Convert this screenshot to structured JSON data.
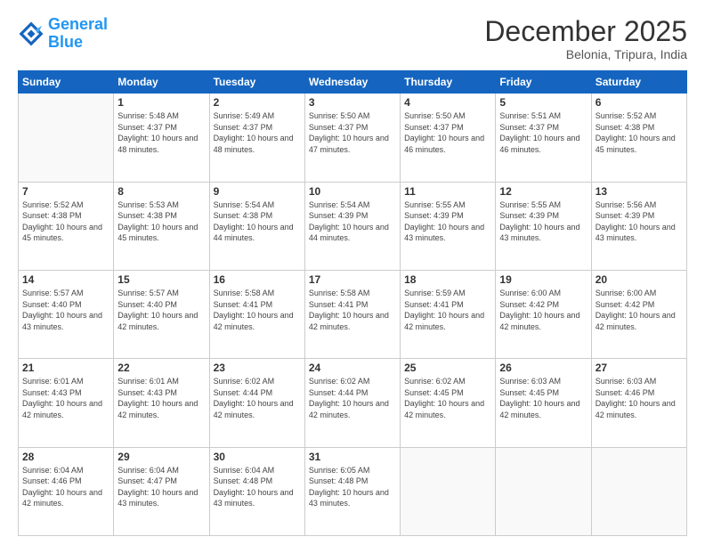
{
  "logo": {
    "line1": "General",
    "line2": "Blue"
  },
  "header": {
    "title": "December 2025",
    "location": "Belonia, Tripura, India"
  },
  "weekdays": [
    "Sunday",
    "Monday",
    "Tuesday",
    "Wednesday",
    "Thursday",
    "Friday",
    "Saturday"
  ],
  "weeks": [
    [
      {
        "day": "",
        "sunrise": "",
        "sunset": "",
        "daylight": ""
      },
      {
        "day": "1",
        "sunrise": "Sunrise: 5:48 AM",
        "sunset": "Sunset: 4:37 PM",
        "daylight": "Daylight: 10 hours and 48 minutes."
      },
      {
        "day": "2",
        "sunrise": "Sunrise: 5:49 AM",
        "sunset": "Sunset: 4:37 PM",
        "daylight": "Daylight: 10 hours and 48 minutes."
      },
      {
        "day": "3",
        "sunrise": "Sunrise: 5:50 AM",
        "sunset": "Sunset: 4:37 PM",
        "daylight": "Daylight: 10 hours and 47 minutes."
      },
      {
        "day": "4",
        "sunrise": "Sunrise: 5:50 AM",
        "sunset": "Sunset: 4:37 PM",
        "daylight": "Daylight: 10 hours and 46 minutes."
      },
      {
        "day": "5",
        "sunrise": "Sunrise: 5:51 AM",
        "sunset": "Sunset: 4:37 PM",
        "daylight": "Daylight: 10 hours and 46 minutes."
      },
      {
        "day": "6",
        "sunrise": "Sunrise: 5:52 AM",
        "sunset": "Sunset: 4:38 PM",
        "daylight": "Daylight: 10 hours and 45 minutes."
      }
    ],
    [
      {
        "day": "7",
        "sunrise": "Sunrise: 5:52 AM",
        "sunset": "Sunset: 4:38 PM",
        "daylight": "Daylight: 10 hours and 45 minutes."
      },
      {
        "day": "8",
        "sunrise": "Sunrise: 5:53 AM",
        "sunset": "Sunset: 4:38 PM",
        "daylight": "Daylight: 10 hours and 45 minutes."
      },
      {
        "day": "9",
        "sunrise": "Sunrise: 5:54 AM",
        "sunset": "Sunset: 4:38 PM",
        "daylight": "Daylight: 10 hours and 44 minutes."
      },
      {
        "day": "10",
        "sunrise": "Sunrise: 5:54 AM",
        "sunset": "Sunset: 4:39 PM",
        "daylight": "Daylight: 10 hours and 44 minutes."
      },
      {
        "day": "11",
        "sunrise": "Sunrise: 5:55 AM",
        "sunset": "Sunset: 4:39 PM",
        "daylight": "Daylight: 10 hours and 43 minutes."
      },
      {
        "day": "12",
        "sunrise": "Sunrise: 5:55 AM",
        "sunset": "Sunset: 4:39 PM",
        "daylight": "Daylight: 10 hours and 43 minutes."
      },
      {
        "day": "13",
        "sunrise": "Sunrise: 5:56 AM",
        "sunset": "Sunset: 4:39 PM",
        "daylight": "Daylight: 10 hours and 43 minutes."
      }
    ],
    [
      {
        "day": "14",
        "sunrise": "Sunrise: 5:57 AM",
        "sunset": "Sunset: 4:40 PM",
        "daylight": "Daylight: 10 hours and 43 minutes."
      },
      {
        "day": "15",
        "sunrise": "Sunrise: 5:57 AM",
        "sunset": "Sunset: 4:40 PM",
        "daylight": "Daylight: 10 hours and 42 minutes."
      },
      {
        "day": "16",
        "sunrise": "Sunrise: 5:58 AM",
        "sunset": "Sunset: 4:41 PM",
        "daylight": "Daylight: 10 hours and 42 minutes."
      },
      {
        "day": "17",
        "sunrise": "Sunrise: 5:58 AM",
        "sunset": "Sunset: 4:41 PM",
        "daylight": "Daylight: 10 hours and 42 minutes."
      },
      {
        "day": "18",
        "sunrise": "Sunrise: 5:59 AM",
        "sunset": "Sunset: 4:41 PM",
        "daylight": "Daylight: 10 hours and 42 minutes."
      },
      {
        "day": "19",
        "sunrise": "Sunrise: 6:00 AM",
        "sunset": "Sunset: 4:42 PM",
        "daylight": "Daylight: 10 hours and 42 minutes."
      },
      {
        "day": "20",
        "sunrise": "Sunrise: 6:00 AM",
        "sunset": "Sunset: 4:42 PM",
        "daylight": "Daylight: 10 hours and 42 minutes."
      }
    ],
    [
      {
        "day": "21",
        "sunrise": "Sunrise: 6:01 AM",
        "sunset": "Sunset: 4:43 PM",
        "daylight": "Daylight: 10 hours and 42 minutes."
      },
      {
        "day": "22",
        "sunrise": "Sunrise: 6:01 AM",
        "sunset": "Sunset: 4:43 PM",
        "daylight": "Daylight: 10 hours and 42 minutes."
      },
      {
        "day": "23",
        "sunrise": "Sunrise: 6:02 AM",
        "sunset": "Sunset: 4:44 PM",
        "daylight": "Daylight: 10 hours and 42 minutes."
      },
      {
        "day": "24",
        "sunrise": "Sunrise: 6:02 AM",
        "sunset": "Sunset: 4:44 PM",
        "daylight": "Daylight: 10 hours and 42 minutes."
      },
      {
        "day": "25",
        "sunrise": "Sunrise: 6:02 AM",
        "sunset": "Sunset: 4:45 PM",
        "daylight": "Daylight: 10 hours and 42 minutes."
      },
      {
        "day": "26",
        "sunrise": "Sunrise: 6:03 AM",
        "sunset": "Sunset: 4:45 PM",
        "daylight": "Daylight: 10 hours and 42 minutes."
      },
      {
        "day": "27",
        "sunrise": "Sunrise: 6:03 AM",
        "sunset": "Sunset: 4:46 PM",
        "daylight": "Daylight: 10 hours and 42 minutes."
      }
    ],
    [
      {
        "day": "28",
        "sunrise": "Sunrise: 6:04 AM",
        "sunset": "Sunset: 4:46 PM",
        "daylight": "Daylight: 10 hours and 42 minutes."
      },
      {
        "day": "29",
        "sunrise": "Sunrise: 6:04 AM",
        "sunset": "Sunset: 4:47 PM",
        "daylight": "Daylight: 10 hours and 43 minutes."
      },
      {
        "day": "30",
        "sunrise": "Sunrise: 6:04 AM",
        "sunset": "Sunset: 4:48 PM",
        "daylight": "Daylight: 10 hours and 43 minutes."
      },
      {
        "day": "31",
        "sunrise": "Sunrise: 6:05 AM",
        "sunset": "Sunset: 4:48 PM",
        "daylight": "Daylight: 10 hours and 43 minutes."
      },
      {
        "day": "",
        "sunrise": "",
        "sunset": "",
        "daylight": ""
      },
      {
        "day": "",
        "sunrise": "",
        "sunset": "",
        "daylight": ""
      },
      {
        "day": "",
        "sunrise": "",
        "sunset": "",
        "daylight": ""
      }
    ]
  ]
}
